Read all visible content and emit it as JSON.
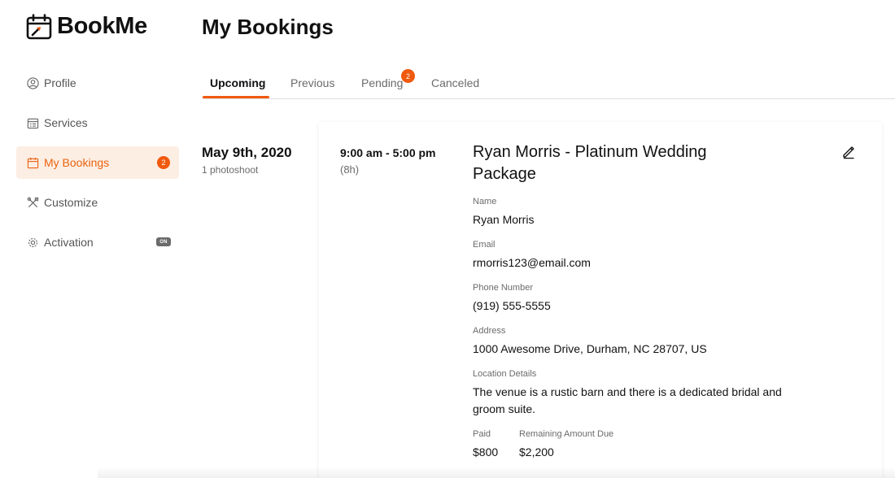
{
  "app": {
    "name": "BookMe",
    "brand_color": "#f05a0f",
    "active_bg": "#fdeee3"
  },
  "sidebar": {
    "items": [
      {
        "label": "Profile",
        "icon": "user-circle-icon"
      },
      {
        "label": "Services",
        "icon": "calendar-list-icon"
      },
      {
        "label": "My Bookings",
        "icon": "calendar-icon",
        "badge": "2",
        "active": true
      },
      {
        "label": "Customize",
        "icon": "tools-icon"
      },
      {
        "label": "Activation",
        "icon": "gear-icon",
        "toggle": "ON"
      }
    ]
  },
  "header": {
    "title": "My Bookings"
  },
  "tabs": [
    {
      "label": "Upcoming",
      "active": true
    },
    {
      "label": "Previous"
    },
    {
      "label": "Pending",
      "badge": "2"
    },
    {
      "label": "Canceled"
    }
  ],
  "booking": {
    "date": "May 9th, 2020",
    "count": "1 photoshoot",
    "time_range": "9:00 am - 5:00 pm",
    "duration": "(8h)",
    "title": "Ryan Morris - Platinum Wedding Package",
    "fields": {
      "name": {
        "label": "Name",
        "value": "Ryan Morris"
      },
      "email": {
        "label": "Email",
        "value": "rmorris123@email.com"
      },
      "phone": {
        "label": "Phone Number",
        "value": "(919) 555-5555"
      },
      "address": {
        "label": "Address",
        "value": "1000 Awesome Drive, Durham, NC 28707, US"
      },
      "location": {
        "label": "Location Details",
        "value": "The venue is a rustic barn and there is a dedicated bridal and groom suite."
      },
      "paid": {
        "label": "Paid",
        "value": "$800"
      },
      "remaining": {
        "label": "Remaining Amount Due",
        "value": "$2,200"
      }
    }
  }
}
